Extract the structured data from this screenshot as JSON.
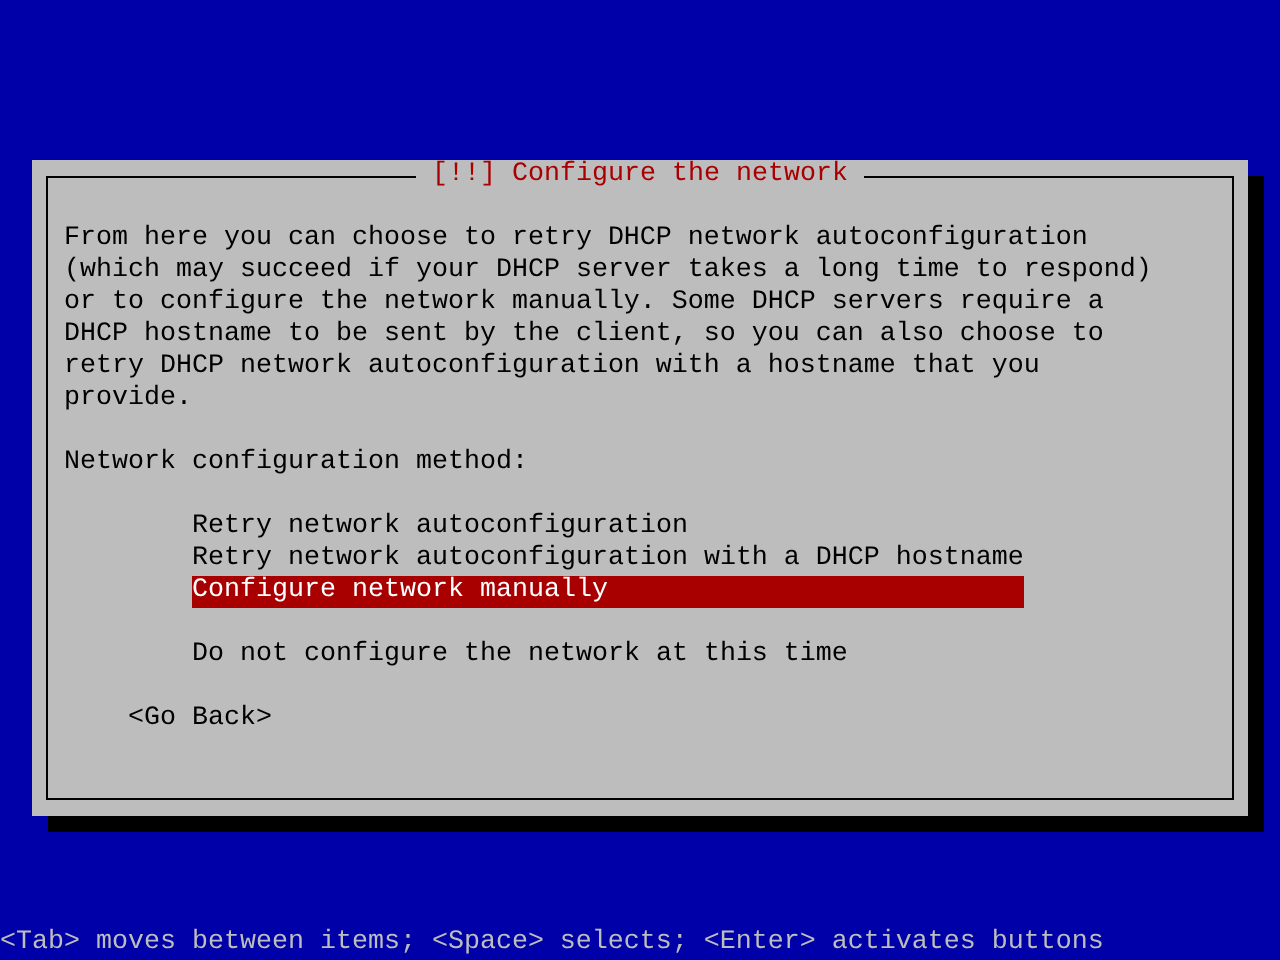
{
  "dialog": {
    "title": "[!!] Configure the network",
    "description": "From here you can choose to retry DHCP network autoconfiguration\n(which may succeed if your DHCP server takes a long time to respond)\nor to configure the network manually. Some DHCP servers require a\nDHCP hostname to be sent by the client, so you can also choose to\nretry DHCP network autoconfiguration with a hostname that you\nprovide.",
    "prompt": "Network configuration method:",
    "option_groups": [
      {
        "options": [
          {
            "label": "Retry network autoconfiguration",
            "selected": false
          },
          {
            "label": "Retry network autoconfiguration with a DHCP hostname",
            "selected": false
          },
          {
            "label": "Configure network manually",
            "selected": true
          }
        ]
      },
      {
        "options": [
          {
            "label": "Do not configure the network at this time",
            "selected": false
          }
        ]
      }
    ],
    "buttons": [
      {
        "label": "<Go Back>",
        "selected": false
      }
    ]
  },
  "help_line": "<Tab> moves between items; <Space> selects; <Enter> activates buttons"
}
